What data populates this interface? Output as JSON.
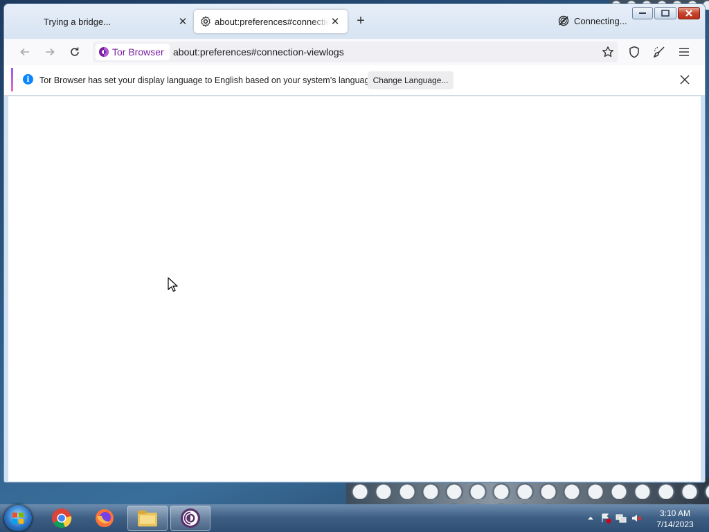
{
  "browser": {
    "tabs": [
      {
        "title": "Trying a bridge..."
      },
      {
        "title": "about:preferences#connection-viewlogs"
      }
    ],
    "status": "Connecting...",
    "identity_label": "Tor Browser",
    "url": "about:preferences#connection-viewlogs",
    "notification": {
      "message": "Tor Browser has set your display language to English based on your system’s language.",
      "button": "Change Language..."
    }
  },
  "taskbar": {
    "apps": [
      "chrome-icon",
      "firefox-icon",
      "file-explorer-icon",
      "tor-browser-icon"
    ],
    "clock": {
      "time": "3:10 AM",
      "date": "7/14/2023"
    }
  },
  "colors": {
    "tor_purple": "#7b1fa2",
    "info_blue": "#0a84ff"
  }
}
